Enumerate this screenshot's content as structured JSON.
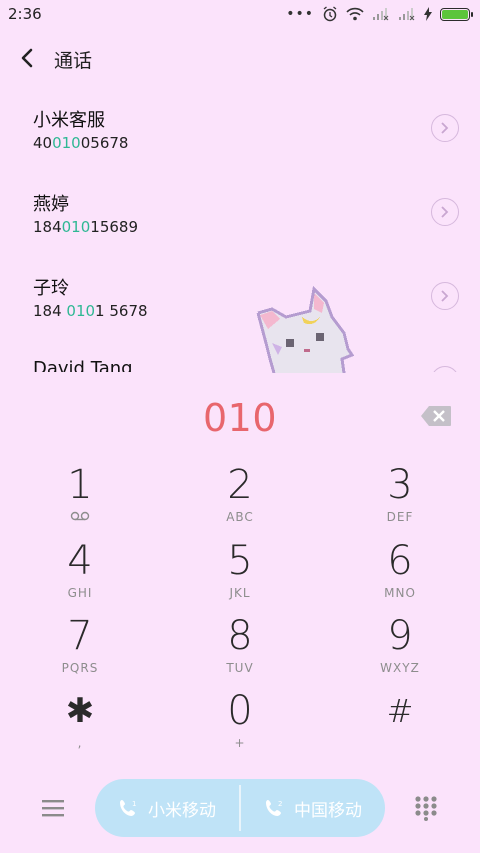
{
  "status_bar": {
    "time": "2:36"
  },
  "header": {
    "title": "通话"
  },
  "contacts": [
    {
      "name": "小米客服",
      "number_pre": "40",
      "number_match": "010",
      "number_post": "05678"
    },
    {
      "name": "燕婷",
      "number_pre": "184",
      "number_match": "010",
      "number_post": "15689"
    },
    {
      "name": "子玲",
      "number_pre": "184 ",
      "number_match": "010",
      "number_post": "1 5678"
    },
    {
      "name": "David Tang",
      "number_pre": "",
      "number_match": "",
      "number_post": ""
    }
  ],
  "dialer": {
    "input": "010"
  },
  "keypad": [
    {
      "digit": "1",
      "letters": ""
    },
    {
      "digit": "2",
      "letters": "ABC"
    },
    {
      "digit": "3",
      "letters": "DEF"
    },
    {
      "digit": "4",
      "letters": "GHI"
    },
    {
      "digit": "5",
      "letters": "JKL"
    },
    {
      "digit": "6",
      "letters": "MNO"
    },
    {
      "digit": "7",
      "letters": "PQRS"
    },
    {
      "digit": "8",
      "letters": "TUV"
    },
    {
      "digit": "9",
      "letters": "WXYZ"
    },
    {
      "digit": "✱",
      "letters": ","
    },
    {
      "digit": "0",
      "letters": "+"
    },
    {
      "digit": "#",
      "letters": ""
    }
  ],
  "sim_buttons": {
    "sim1_label": "小米移动",
    "sim2_label": "中国移动"
  },
  "colors": {
    "background": "#fbe3fb",
    "match_highlight": "#2fb894",
    "input_text": "#e8666d",
    "call_button": "#bfe3f7"
  }
}
